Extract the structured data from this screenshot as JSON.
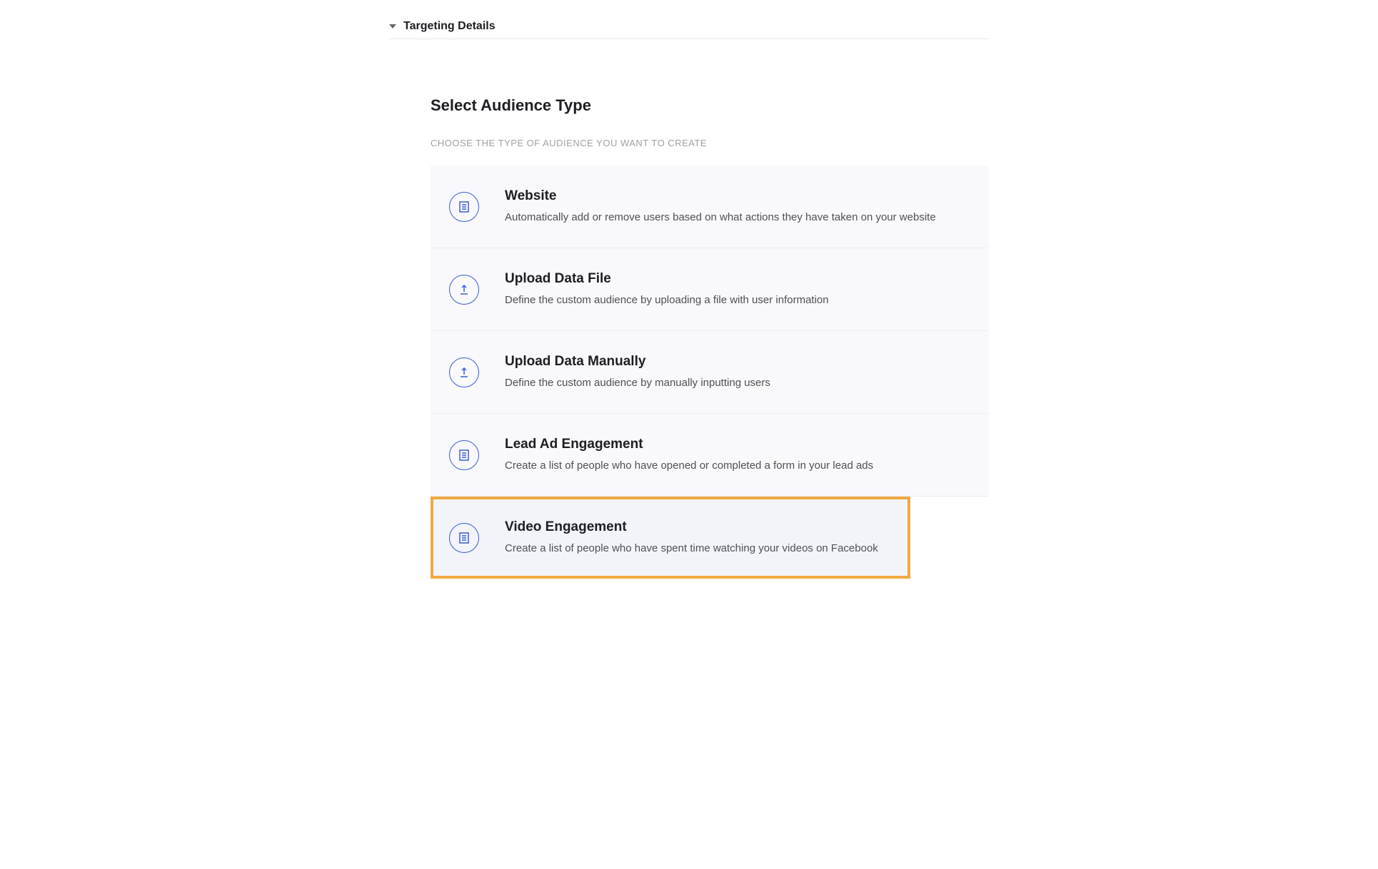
{
  "section_header": {
    "title": "Targeting Details"
  },
  "page": {
    "title": "Select Audience Type",
    "subtitle": "CHOOSE THE TYPE OF AUDIENCE YOU WANT TO CREATE"
  },
  "options": [
    {
      "icon": "document",
      "title": "Website",
      "description": "Automatically add or remove users based on what actions they have taken on your website",
      "highlighted": false
    },
    {
      "icon": "upload",
      "title": "Upload Data File",
      "description": "Define the custom audience by uploading a file with user information",
      "highlighted": false
    },
    {
      "icon": "upload",
      "title": "Upload Data Manually",
      "description": "Define the custom audience by manually inputting users",
      "highlighted": false
    },
    {
      "icon": "document",
      "title": "Lead Ad Engagement",
      "description": "Create a list of people who have opened or completed a form in your lead ads",
      "highlighted": false
    },
    {
      "icon": "document",
      "title": "Video Engagement",
      "description": "Create a list of people who have spent time watching your videos on Facebook",
      "highlighted": true
    }
  ]
}
